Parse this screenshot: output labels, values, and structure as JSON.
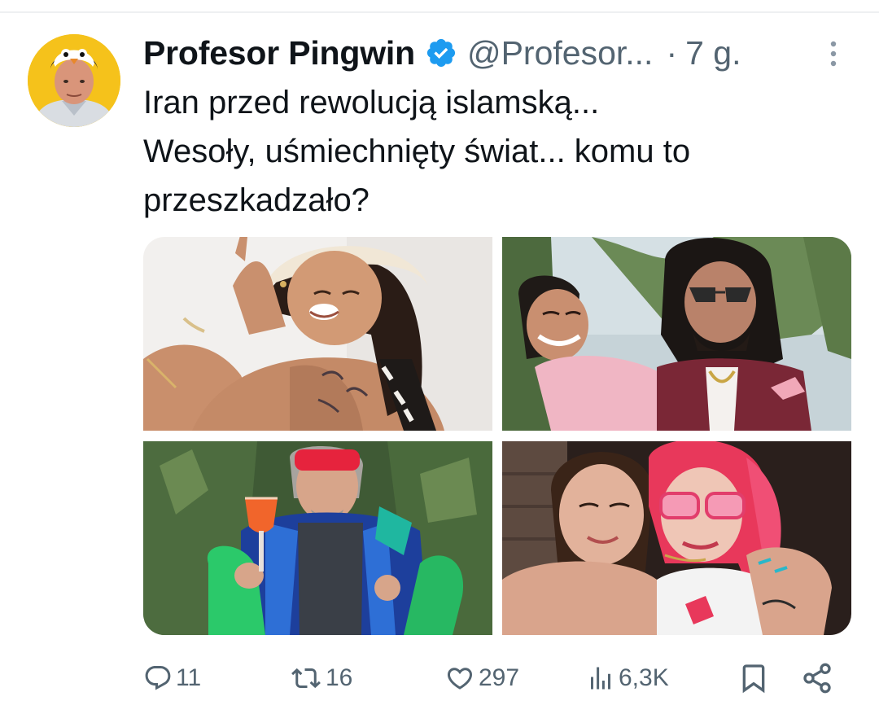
{
  "tweet": {
    "author_name": "Profesor Pingwin",
    "handle": "@Profesor...",
    "separator": "·",
    "time": "7 g.",
    "text_lines": [
      "Iran przed rewolucją islamską...",
      "Wesoły, uśmiechnięty świat... komu to",
      "przeszkadzało?"
    ]
  },
  "icons": {
    "verified": "verified-badge-icon",
    "more": "more-options-icon",
    "reply": "reply-icon",
    "retweet": "retweet-icon",
    "like": "like-icon",
    "views": "views-icon",
    "bookmark": "bookmark-icon",
    "share": "share-icon"
  },
  "actions": {
    "replies": "11",
    "retweets": "16",
    "likes": "297",
    "views": "6,3K"
  },
  "colors": {
    "text": "#0f1419",
    "secondary": "#536471",
    "verified": "#1d9bf0",
    "avatar_bg": "#f5c21b"
  }
}
